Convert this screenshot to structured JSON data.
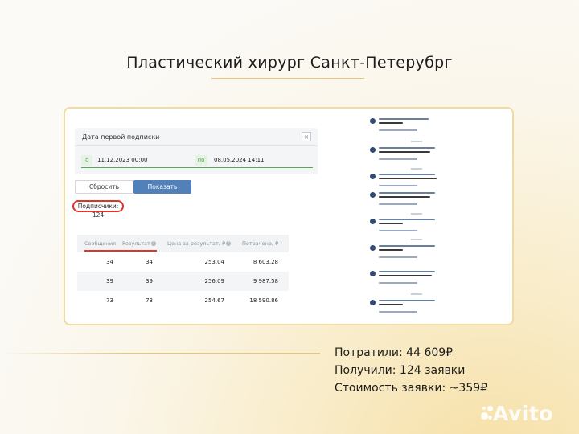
{
  "title": "Пластический хирург Санкт-Петерубрг",
  "filter": {
    "heading": "Дата первой подписки",
    "close_symbol": "×",
    "from_label": "с",
    "from_value": "11.12.2023 00:00",
    "to_label": "по",
    "to_value": "08.05.2024 14:11"
  },
  "buttons": {
    "reset": "Сбросить",
    "show": "Показать"
  },
  "subscribers": "Подписчики: 124",
  "table": {
    "headers": [
      "Сообщения",
      "Результат",
      "Цена за результат, ₽",
      "Потрачено, ₽"
    ],
    "help_symbol": "?",
    "rows": [
      [
        "34",
        "34",
        "253.04",
        "8 603.28"
      ],
      [
        "39",
        "39",
        "256.09",
        "9 987.58"
      ],
      [
        "73",
        "73",
        "254.67",
        "18 590.86"
      ]
    ]
  },
  "stats": {
    "spent": "Потратили: 44 609₽",
    "received": "Получили: 124 заявки",
    "cost": "Стоимость заявки: ~359₽"
  },
  "watermark": "Avito"
}
